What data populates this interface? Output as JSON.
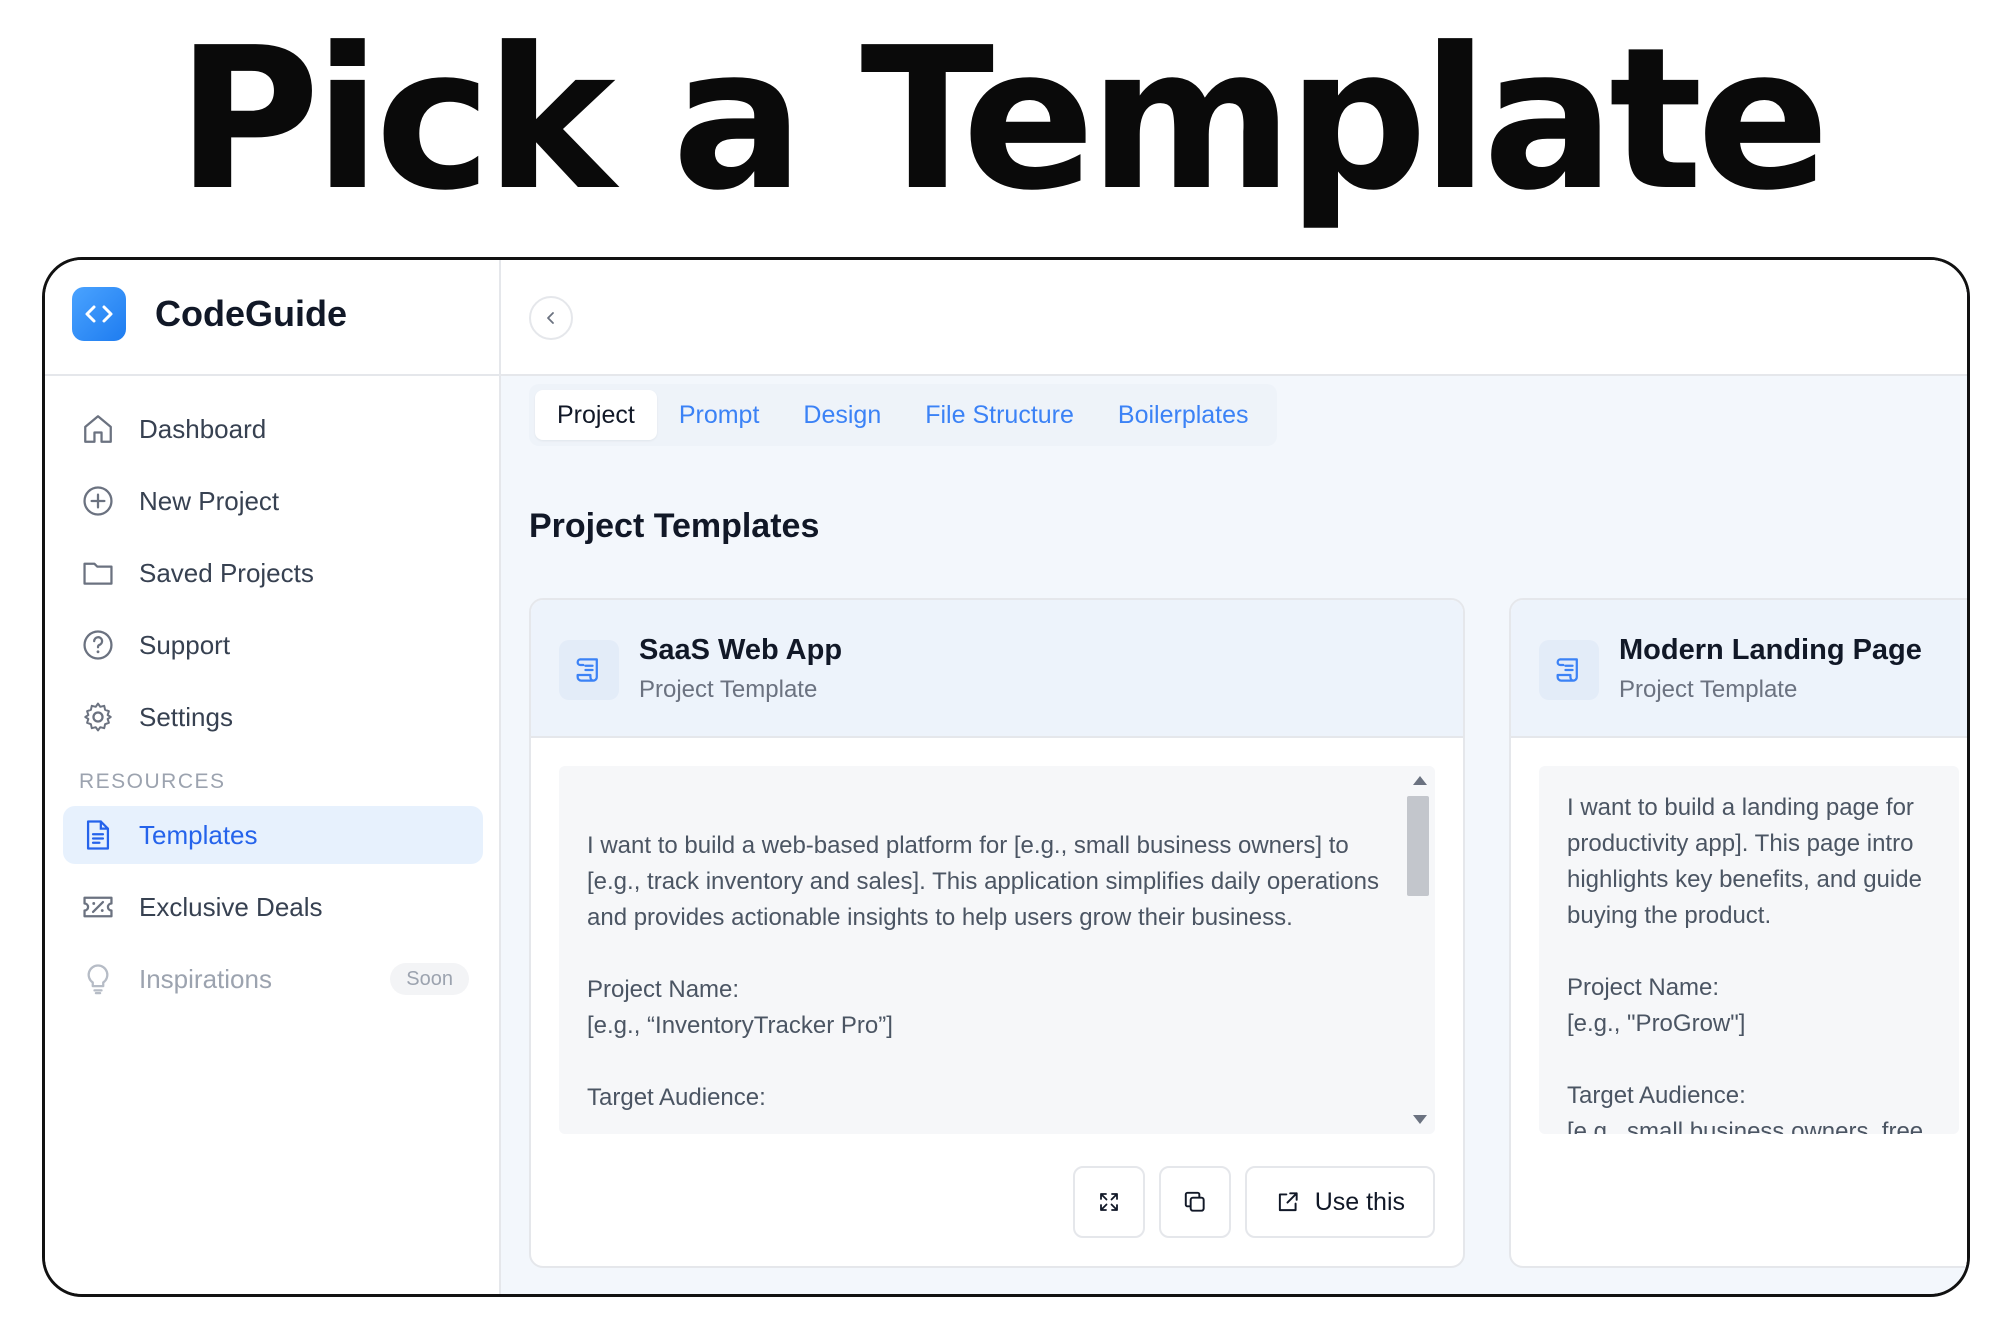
{
  "hero": {
    "title": "Pick a Template"
  },
  "brand": {
    "name": "CodeGuide",
    "accent": "#2f8bf5"
  },
  "sidebar": {
    "items": [
      {
        "label": "Dashboard",
        "icon": "home-icon"
      },
      {
        "label": "New Project",
        "icon": "plus-circle-icon"
      },
      {
        "label": "Saved Projects",
        "icon": "folder-icon"
      },
      {
        "label": "Support",
        "icon": "help-circle-icon"
      },
      {
        "label": "Settings",
        "icon": "gear-icon"
      }
    ],
    "section_label": "RESOURCES",
    "resources": [
      {
        "label": "Templates",
        "icon": "document-icon",
        "active": true
      },
      {
        "label": "Exclusive Deals",
        "icon": "ticket-icon"
      },
      {
        "label": "Inspirations",
        "icon": "lightbulb-icon",
        "badge": "Soon",
        "disabled": true
      }
    ]
  },
  "tabs": [
    {
      "label": "Project",
      "active": true
    },
    {
      "label": "Prompt"
    },
    {
      "label": "Design"
    },
    {
      "label": "File Structure"
    },
    {
      "label": "Boilerplates"
    }
  ],
  "main": {
    "section_title": "Project Templates"
  },
  "cards": [
    {
      "title": "SaaS Web App",
      "subtitle": "Project Template",
      "prompt": "I want to build a web-based platform for [e.g., small business owners] to [e.g., track inventory and sales]. This application simplifies daily operations and provides actionable insights to help users grow their business.\n\nProject Name:\n[e.g., “InventoryTracker Pro”]\n\nTarget Audience:",
      "use_label": "Use this"
    },
    {
      "title": "Modern Landing Page",
      "subtitle": "Project Template",
      "prompt": "I want to build a landing page for\nproductivity app]. This page intro\nhighlights key benefits, and guide\nbuying the product.\n\nProject Name:\n[e.g., \"ProGrow\"]\n\nTarget Audience:\n[e.g., small business owners, free"
    }
  ]
}
